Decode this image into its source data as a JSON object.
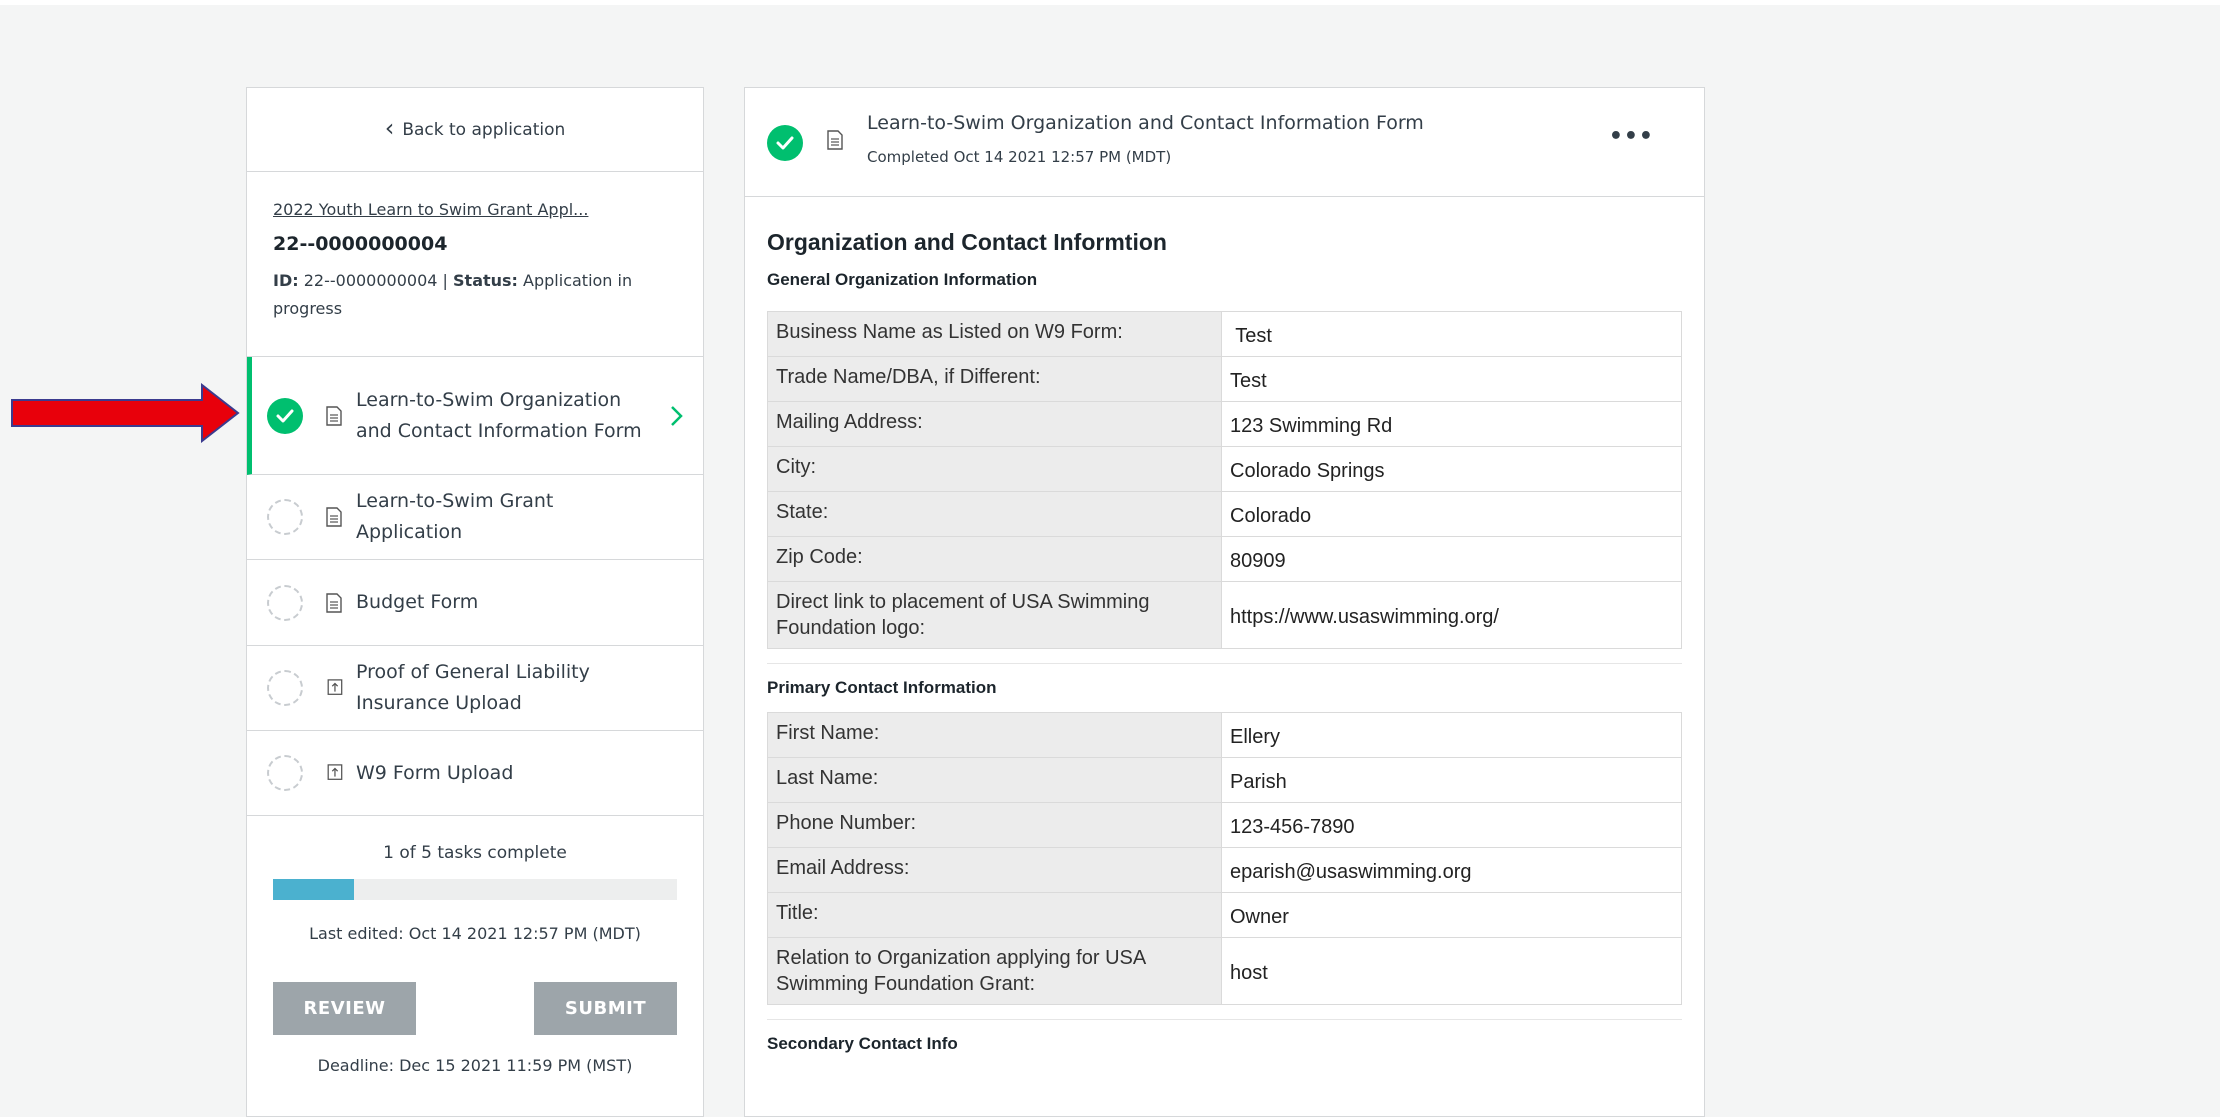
{
  "sidebar": {
    "back_label": "Back to application",
    "app_title": "2022 Youth Learn to Swim Grant Appl...",
    "app_number": "22--0000000004",
    "id_label": "ID:",
    "id_value": "22--0000000004",
    "status_label": "Status:",
    "status_value": "Application in progress",
    "tasks": [
      {
        "label": "Learn-to-Swim Organization and Contact Information Form",
        "state": "complete",
        "icon": "document-icon"
      },
      {
        "label": "Learn-to-Swim Grant Application",
        "state": "pending",
        "icon": "document-icon"
      },
      {
        "label": "Budget Form",
        "state": "pending",
        "icon": "document-icon"
      },
      {
        "label": "Proof of General Liability Insurance Upload",
        "state": "pending",
        "icon": "upload-icon"
      },
      {
        "label": "W9 Form Upload",
        "state": "pending",
        "icon": "upload-icon"
      }
    ],
    "progress_text": "1 of 5 tasks complete",
    "progress_fraction": 0.2,
    "last_edited": "Last edited: Oct 14 2021 12:57 PM (MDT)",
    "review_label": "REVIEW",
    "submit_label": "SUBMIT",
    "deadline": "Deadline: Dec 15 2021 11:59 PM (MST)"
  },
  "form": {
    "title": "Learn-to-Swim Organization and Contact Information Form",
    "completed": "Completed Oct 14 2021 12:57 PM (MDT)",
    "section_title": "Organization and Contact Informtion",
    "general_title": "General Organization Information",
    "general_rows": [
      {
        "k": "Business Name as Listed on W9 Form:",
        "v": " Test"
      },
      {
        "k": "Trade Name/DBA, if Different:",
        "v": "Test"
      },
      {
        "k": "Mailing Address:",
        "v": "123 Swimming Rd"
      },
      {
        "k": "City:",
        "v": "Colorado Springs"
      },
      {
        "k": "State:",
        "v": "Colorado"
      },
      {
        "k": "Zip Code:",
        "v": "80909"
      },
      {
        "k": "Direct link to placement of USA Swimming Foundation logo:",
        "v": "https://www.usaswimming.org/"
      }
    ],
    "primary_title": "Primary Contact Information",
    "primary_rows": [
      {
        "k": "First Name:",
        "v": "Ellery"
      },
      {
        "k": "Last Name:",
        "v": "Parish"
      },
      {
        "k": "Phone Number:",
        "v": "123-456-7890"
      },
      {
        "k": "Email Address:",
        "v": "eparish@usaswimming.org"
      },
      {
        "k": "Title:",
        "v": "Owner"
      },
      {
        "k": "Relation to Organization applying for USA Swimming Foundation Grant:",
        "v": "host"
      }
    ],
    "secondary_title": "Secondary Contact Info"
  },
  "colors": {
    "accent_green": "#00bf6f",
    "progress_blue": "#4bb1cf",
    "button_gray": "#9da5aa",
    "annotation_red": "#e8000b"
  }
}
